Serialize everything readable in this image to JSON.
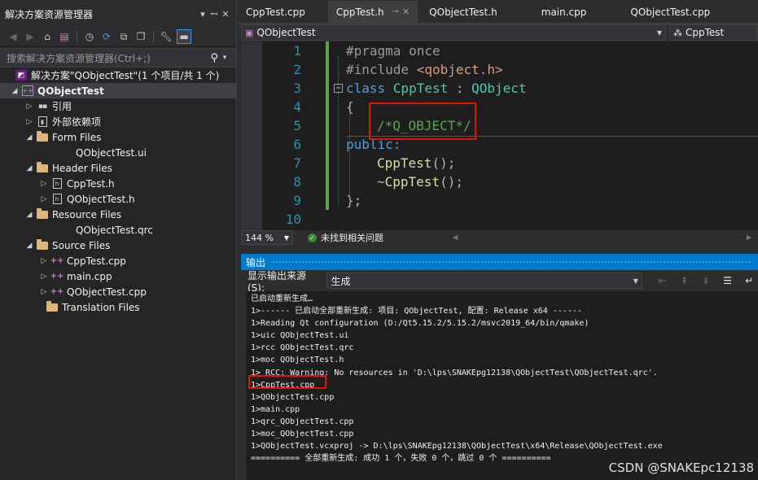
{
  "solution_explorer": {
    "title": "解决方案资源管理器",
    "search_placeholder": "搜索解决方案资源管理器(Ctrl+;)",
    "tree": [
      {
        "label": "解决方案\"QObjectTest\"(1 个项目/共 1 个)",
        "icon": "solution-icon"
      },
      {
        "label": "QObjectTest",
        "icon": "project-icon"
      },
      {
        "label": "引用",
        "icon": "references-icon"
      },
      {
        "label": "外部依赖项",
        "icon": "external-deps-icon"
      },
      {
        "label": "Form Files",
        "icon": "folder-icon"
      },
      {
        "label": "QObjectTest.ui",
        "icon": "ui-file-icon"
      },
      {
        "label": "Header Files",
        "icon": "folder-icon"
      },
      {
        "label": "CppTest.h",
        "icon": "header-file-icon"
      },
      {
        "label": "QObjectTest.h",
        "icon": "header-file-icon"
      },
      {
        "label": "Resource Files",
        "icon": "folder-icon"
      },
      {
        "label": "QObjectTest.qrc",
        "icon": "qrc-file-icon"
      },
      {
        "label": "Source Files",
        "icon": "folder-icon"
      },
      {
        "label": "CppTest.cpp",
        "icon": "cpp-file-icon"
      },
      {
        "label": "main.cpp",
        "icon": "cpp-file-icon"
      },
      {
        "label": "QObjectTest.cpp",
        "icon": "cpp-file-icon"
      },
      {
        "label": "Translation Files",
        "icon": "folder-icon"
      }
    ]
  },
  "tabs": [
    {
      "label": "CppTest.cpp",
      "active": false
    },
    {
      "label": "CppTest.h",
      "active": true
    },
    {
      "label": "QObjectTest.h",
      "active": false
    },
    {
      "label": "main.cpp",
      "active": false
    },
    {
      "label": "QObjectTest.cpp",
      "active": false
    }
  ],
  "navbar": {
    "scope": "QObjectTest",
    "member": "CppTest"
  },
  "editor": {
    "line_numbers": [
      "1",
      "2",
      "3",
      "4",
      "5",
      "6",
      "7",
      "8",
      "9",
      "10"
    ],
    "lines": {
      "l1": "#pragma once",
      "l2a": "#include ",
      "l2b": "<qobject.h>",
      "l3a": "class ",
      "l3b": "CppTest",
      "l3c": " : ",
      "l3d": "QObject",
      "l4": "{",
      "l5": "/*Q_OBJECT*/",
      "l6": "public:",
      "l7a": "CppTest",
      "l7b": "();",
      "l8a": "~",
      "l8b": "CppTest",
      "l8c": "();",
      "l9": "};"
    },
    "fold_collapse": "−"
  },
  "editor_status": {
    "zoom": "144 %",
    "issues": "未找到相关问题"
  },
  "output": {
    "title": "输出",
    "source_label": "显示输出来源(S):",
    "source_value": "生成",
    "lines": [
      "已启动重新生成…",
      "1>------ 已启动全部重新生成: 项目: QObjectTest, 配置: Release x64 ------",
      "1>Reading Qt configuration (D:/Qt5.15.2/5.15.2/msvc2019_64/bin/qmake)",
      "1>uic QObjectTest.ui",
      "1>rcc QObjectTest.qrc",
      "1>moc QObjectTest.h",
      "1> RCC: Warning: No resources in 'D:\\lps\\SNAKEpg12138\\QObjectTest\\QObjectTest.qrc'.",
      "1>CppTest.cpp",
      "1>QObjectTest.cpp",
      "1>main.cpp",
      "1>qrc_QObjectTest.cpp",
      "1>moc_QObjectTest.cpp",
      "1>QObjectTest.vcxproj -> D:\\lps\\SNAKEpg12138\\QObjectTest\\x64\\Release\\QObjectTest.exe",
      "========== 全部重新生成: 成功 1 个，失败 0 个，跳过 0 个 =========="
    ]
  },
  "watermark": "CSDN @SNAKEpc12138",
  "colors": {
    "accent": "#007acc",
    "highlight_box": "#e51400",
    "change_bar": "#57a64a"
  }
}
